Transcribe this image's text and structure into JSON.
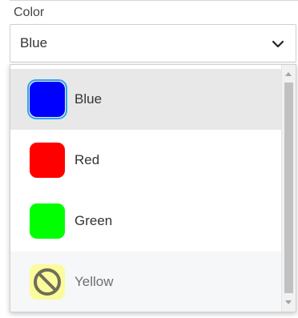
{
  "field": {
    "label": "Color",
    "selected_value": "Blue",
    "chevron_icon": "chevron-down-icon"
  },
  "dropdown": {
    "options": [
      {
        "label": "Blue",
        "color": "#0000ff",
        "state": "selected"
      },
      {
        "label": "Red",
        "color": "#ff0000",
        "state": "normal"
      },
      {
        "label": "Green",
        "color": "#00ff00",
        "state": "normal"
      },
      {
        "label": "Yellow",
        "color": "#fbfb9b",
        "state": "disabled",
        "icon": "prohibited-icon"
      }
    ],
    "scrollbar": {
      "up_icon": "scroll-up-arrow-icon",
      "down_icon": "scroll-down-arrow-icon"
    }
  },
  "colors": {
    "focus_ring": "#2aa7e8",
    "selected_row": "#e8e8e8",
    "disabled_row": "#f6f7f8"
  }
}
